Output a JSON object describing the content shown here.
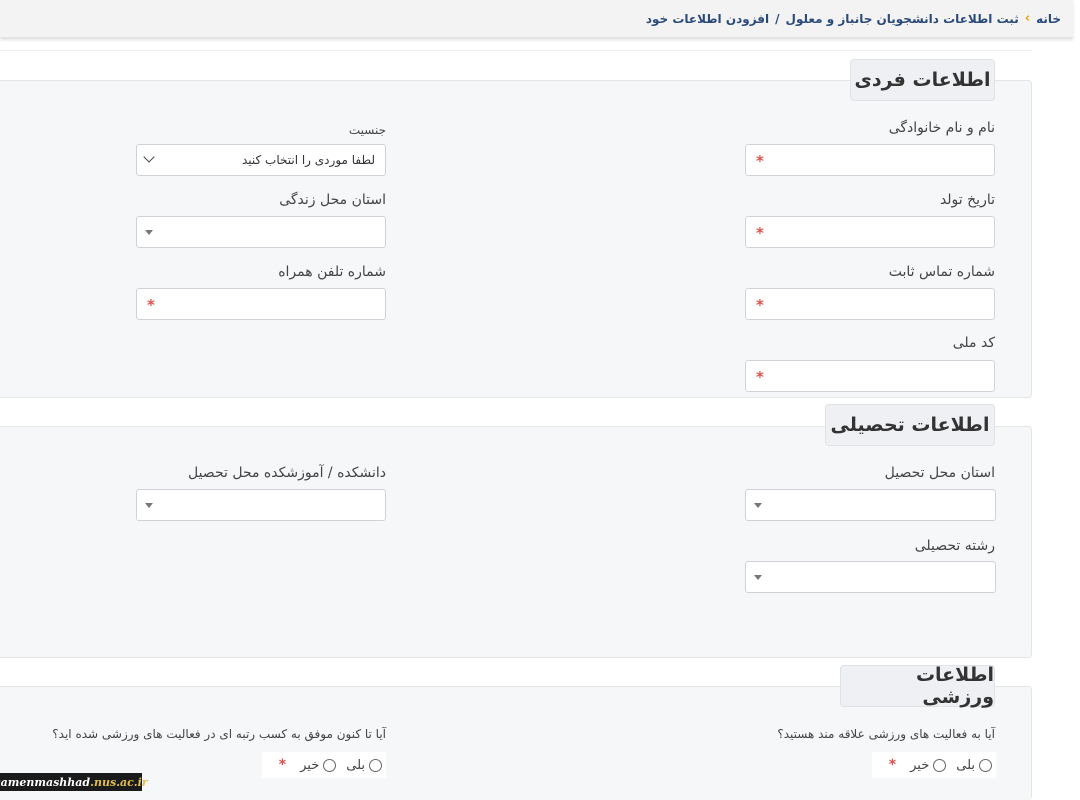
{
  "breadcrumb": {
    "home": "خانه",
    "item1": "ثبت اطلاعات دانشجویان جانباز و معلول",
    "item2": "افزودن اطلاعات خود"
  },
  "personal": {
    "legend": "اطلاعات فردی",
    "full_name_label": "نام و نام خانوادگی",
    "gender_label": "جنسیت",
    "gender_placeholder": "لطفا موردی را انتخاب کنید",
    "birth_date_label": "تاریخ تولد",
    "province_label": "استان محل زندگی",
    "landline_label": "شماره تماس ثابت",
    "mobile_label": "شماره تلفن همراه",
    "national_code_label": "کد ملی",
    "required_mark": "*"
  },
  "education": {
    "legend": "اطلاعات تحصیلی",
    "study_province_label": "استان محل تحصیل",
    "faculty_label": "دانشکده / آموزشکده محل تحصیل",
    "major_label": "رشته تحصیلی"
  },
  "sports": {
    "legend": "اطلاعات ورزشی",
    "interest_question": "آیا به فعالیت های ورزشی علاقه مند هستید؟",
    "achievement_question": "آیا تا کنون موفق به کسب رتبه ای در فعالیت های ورزشی شده اید؟",
    "yes_label": "بلی",
    "no_label": "خیر"
  },
  "watermark": {
    "site": "samenmashhad",
    "domain": ".nus.ac.ir"
  },
  "colors": {
    "required": "#d9534f",
    "breadcrumb_sep": "#e0a020",
    "link": "#2a4a7a"
  }
}
